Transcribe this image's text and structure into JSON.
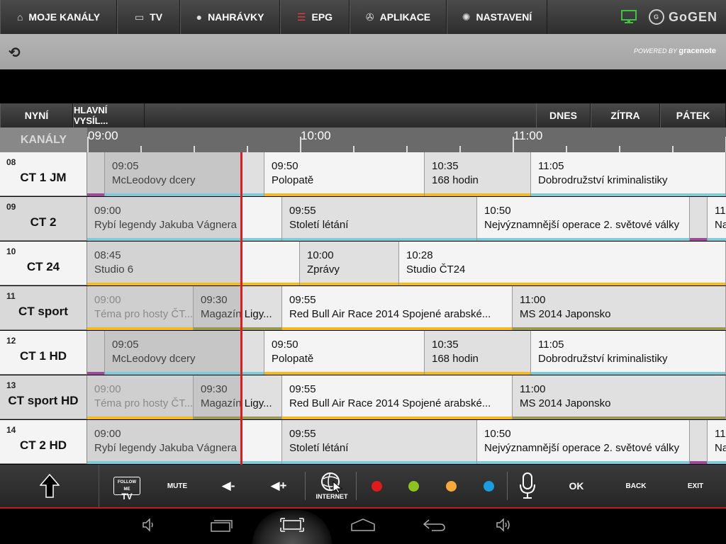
{
  "nav": {
    "items": [
      {
        "label": "MOJE KANÁLY",
        "icon": "home-icon"
      },
      {
        "label": "TV",
        "icon": "monitor-icon"
      },
      {
        "label": "NAHRÁVKY",
        "icon": "record-icon"
      },
      {
        "label": "EPG",
        "icon": "epg-list-icon"
      },
      {
        "label": "APLIKACE",
        "icon": "apps-icon"
      },
      {
        "label": "NASTAVENÍ",
        "icon": "gear-icon"
      }
    ],
    "brand": "GoGEN"
  },
  "subbar": {
    "powered_by": "POWERED BY",
    "provider": "gracenote"
  },
  "filters": {
    "now": "NYNÍ",
    "main": "HLAVNÍ VYSÍL...",
    "today": "DNES",
    "tomorrow": "ZÍTRA",
    "friday": "PÁTEK"
  },
  "timeline": {
    "header": "KANÁLY",
    "times": [
      "09:00",
      "10:00",
      "11:00"
    ]
  },
  "channels": [
    {
      "num": "08",
      "name": "CT 1 JM"
    },
    {
      "num": "09",
      "name": "CT 2"
    },
    {
      "num": "10",
      "name": "CT 24"
    },
    {
      "num": "11",
      "name": "CT sport"
    },
    {
      "num": "12",
      "name": "CT 1 HD"
    },
    {
      "num": "13",
      "name": "CT sport HD"
    },
    {
      "num": "14",
      "name": "CT 2 HD"
    }
  ],
  "programs": [
    [
      {
        "time": "",
        "title": "",
        "bar": "purple"
      },
      {
        "time": "09:05",
        "title": "McLeodovy dcery",
        "bar": "blue"
      },
      {
        "time": "09:50",
        "title": "Polopatě",
        "bar": "yellow"
      },
      {
        "time": "10:35",
        "title": "168 hodin",
        "bar": "yellow"
      },
      {
        "time": "11:05",
        "title": "Dobrodružství kriminalistiky",
        "bar": "blue"
      }
    ],
    [
      {
        "time": "09:00",
        "title": "Rybí legendy Jakuba Vágnera",
        "bar": "blue"
      },
      {
        "time": "09:55",
        "title": "Století létání",
        "bar": "blue"
      },
      {
        "time": "10:50",
        "title": "Nejvýznamnější operace 2. světové války",
        "bar": "blue"
      },
      {
        "time": "",
        "title": "",
        "bar": "purple"
      },
      {
        "time": "11",
        "title": "Na",
        "bar": "blue"
      }
    ],
    [
      {
        "time": "08:45",
        "title": "Studio 6",
        "bar": "yellow"
      },
      {
        "time": "10:00",
        "title": "Zprávy",
        "bar": "yellow"
      },
      {
        "time": "10:28",
        "title": "Studio ČT24",
        "bar": "yellow"
      }
    ],
    [
      {
        "time": "09:00",
        "title": "Téma pro hosty ČT...",
        "bar": "yellow"
      },
      {
        "time": "09:30",
        "title": "Magazín Ligy...",
        "bar": "olive"
      },
      {
        "time": "09:55",
        "title": "Red Bull Air Race 2014 Spojené arabské...",
        "bar": "yellow"
      },
      {
        "time": "11:00",
        "title": "MS 2014 Japonsko",
        "bar": "olive"
      }
    ],
    [
      {
        "time": "",
        "title": "",
        "bar": "purple"
      },
      {
        "time": "09:05",
        "title": "McLeodovy dcery",
        "bar": "blue"
      },
      {
        "time": "09:50",
        "title": "Polopatě",
        "bar": "yellow"
      },
      {
        "time": "10:35",
        "title": "168 hodin",
        "bar": "yellow"
      },
      {
        "time": "11:05",
        "title": "Dobrodružství kriminalistiky",
        "bar": "blue"
      }
    ],
    [
      {
        "time": "09:00",
        "title": "Téma pro hosty ČT...",
        "bar": "yellow"
      },
      {
        "time": "09:30",
        "title": "Magazín Ligy...",
        "bar": "olive"
      },
      {
        "time": "09:55",
        "title": "Red Bull Air Race 2014 Spojené arabské...",
        "bar": "yellow"
      },
      {
        "time": "11:00",
        "title": "MS 2014 Japonsko",
        "bar": "olive"
      }
    ],
    [
      {
        "time": "09:00",
        "title": "Rybí legendy Jakuba Vágnera",
        "bar": "blue"
      },
      {
        "time": "09:55",
        "title": "Století létání",
        "bar": "blue"
      },
      {
        "time": "10:50",
        "title": "Nejvýznamnější operace 2. světové války",
        "bar": "blue"
      },
      {
        "time": "",
        "title": "",
        "bar": "purple"
      },
      {
        "time": "11",
        "title": "Na",
        "bar": "blue"
      }
    ]
  ],
  "remote": {
    "follow_me": "FOLLOW ME",
    "follow_tv": "TV",
    "mute": "MUTE",
    "vol_down": "◀-",
    "vol_up": "◀+",
    "internet": "INTERNET",
    "ok": "OK",
    "back": "BACK",
    "exit": "EXIT",
    "colors": [
      "#e01b1b",
      "#8dc21f",
      "#f4a93a",
      "#1a9de0"
    ]
  }
}
